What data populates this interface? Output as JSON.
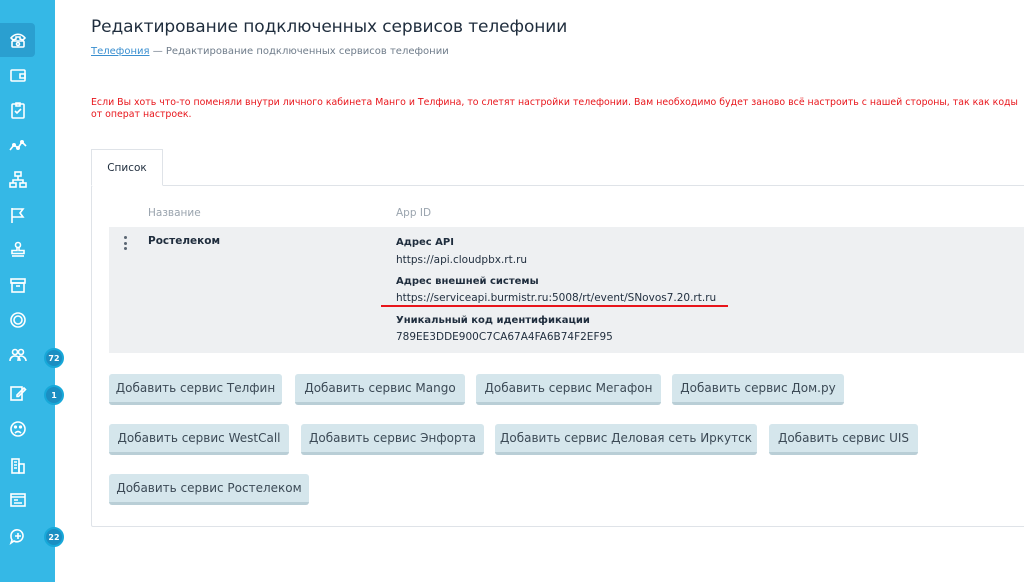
{
  "sidebar": {
    "items": [
      {
        "icon": "phone-icon",
        "active": true
      },
      {
        "icon": "wallet-icon"
      },
      {
        "icon": "clipboard-icon"
      },
      {
        "icon": "chart-icon"
      },
      {
        "icon": "org-structure-icon"
      },
      {
        "icon": "flag-icon"
      },
      {
        "icon": "stamp-icon"
      },
      {
        "icon": "archive-icon"
      },
      {
        "icon": "coin-icon"
      },
      {
        "icon": "users-icon",
        "badge": "72"
      },
      {
        "icon": "edit-icon",
        "badge": "1"
      },
      {
        "icon": "sad-face-icon"
      },
      {
        "icon": "building-icon"
      },
      {
        "icon": "window-icon"
      },
      {
        "icon": "chat-add-icon",
        "badge": "22"
      }
    ]
  },
  "header": {
    "title": "Редактирование подключенных сервисов телефонии",
    "breadcrumb_link": "Телефония",
    "breadcrumb_separator": "—",
    "breadcrumb_current": "Редактирование подключенных сервисов телефонии"
  },
  "warning": "Если Вы хоть что-то поменяли внутри личного кабинета Манго и Телфина, то слетят настройки телефонии. Вам необходимо будет заново всё настроить с нашей стороны, так как коды от операт настроек.",
  "tabs": [
    {
      "label": "Список"
    }
  ],
  "table": {
    "columns": [
      "Название",
      "App ID"
    ],
    "row": {
      "name": "Ростелеком",
      "fields": [
        {
          "label": "Адрес API",
          "value": "https://api.cloudpbx.rt.ru"
        },
        {
          "label": "Адрес внешней системы",
          "value": "https://serviceapi.burmistr.ru:5008/rt/event/SNovos7.20.rt.ru"
        },
        {
          "label": "Уникальный код идентификации",
          "value": "789EE3DDE900C7CA67A4FA6B74F2EF95"
        }
      ]
    }
  },
  "buttons": [
    "Добавить сервис Телфин",
    "Добавить сервис Mango",
    "Добавить сервис Мегафон",
    "Добавить сервис Дом.ру",
    "Добавить сервис WestCall",
    "Добавить сервис Энфорта",
    "Добавить сервис Деловая сеть Иркутск",
    "Добавить сервис UIS",
    "Добавить сервис Ростелеком"
  ],
  "colors": {
    "sidebar": "#35b8e6",
    "warning": "#e8151b",
    "button": "#d5e6ec",
    "link": "#3a8fd0"
  }
}
